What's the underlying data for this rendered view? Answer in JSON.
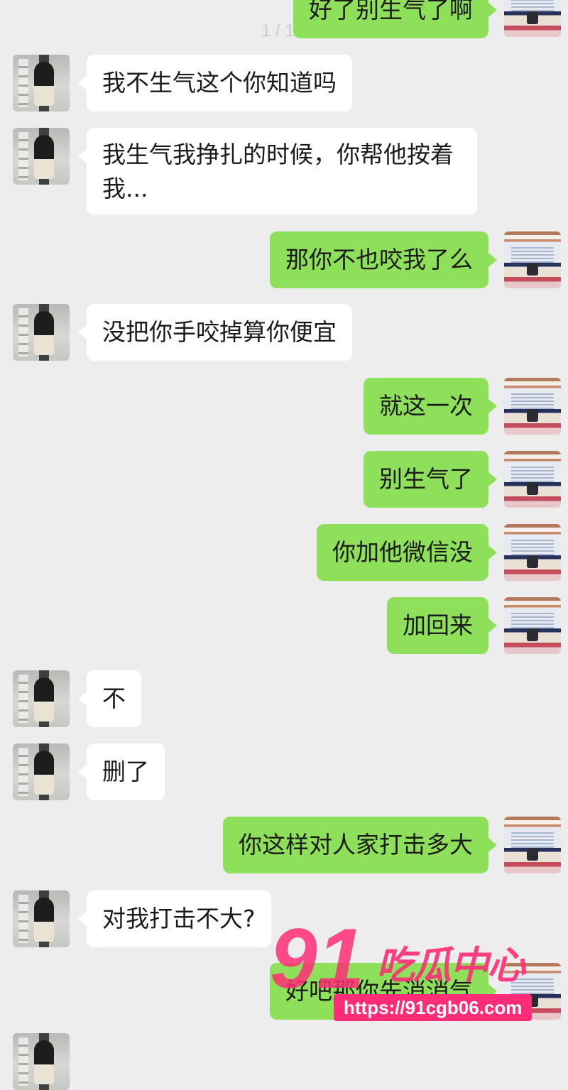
{
  "page_indicator": "1 / 1",
  "messages": [
    {
      "side": "right",
      "text": "好了别生气了啊"
    },
    {
      "side": "left",
      "text": "我不生气这个你知道吗"
    },
    {
      "side": "left",
      "text": "我生气我挣扎的时候，你帮他按着我..."
    },
    {
      "side": "right",
      "text": "那你不也咬我了么"
    },
    {
      "side": "left",
      "text": "没把你手咬掉算你便宜"
    },
    {
      "side": "right",
      "text": "就这一次"
    },
    {
      "side": "right",
      "text": "别生气了"
    },
    {
      "side": "right",
      "text": "你加他微信没"
    },
    {
      "side": "right",
      "text": "加回来"
    },
    {
      "side": "left",
      "text": "不"
    },
    {
      "side": "left",
      "text": "删了"
    },
    {
      "side": "right",
      "text": "你这样对人家打击多大"
    },
    {
      "side": "left",
      "text": "对我打击不大?"
    },
    {
      "side": "right",
      "text": "好吧那你先消消气"
    }
  ],
  "watermark": {
    "logo_number": "91",
    "name": "吃瓜中心",
    "url": "https://91cgb06.com"
  }
}
